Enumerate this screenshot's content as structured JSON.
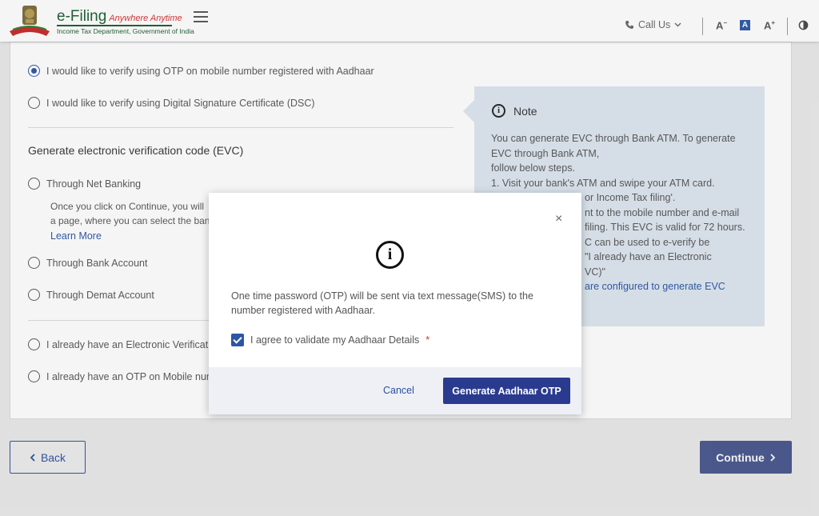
{
  "header": {
    "brand_title": "e-Filing",
    "brand_tagline": "Anywhere Anytime",
    "brand_subtitle": "Income Tax Department, Government of India",
    "call_us": "Call Us",
    "font_decrease": "A",
    "font_default": "A",
    "font_increase": "A"
  },
  "options": {
    "aadhaar_otp": "I would like to verify using OTP on mobile number registered with Aadhaar",
    "dsc": "I would like to verify using Digital Signature Certificate (DSC)",
    "evc_section_title": "Generate electronic verification code (EVC)",
    "net_banking": "Through Net Banking",
    "net_banking_desc_1": "Once you click on Continue, you will",
    "net_banking_desc_2": "a page, where you can select the ban",
    "learn_more": "Learn More",
    "bank_account": "Through Bank Account",
    "demat_account": "Through Demat Account",
    "have_evc": "I already have an Electronic Verificatio",
    "have_otp": "I already have an OTP on Mobile num"
  },
  "note": {
    "title": "Note",
    "lines": [
      "You can generate EVC through Bank ATM. To generate",
      "EVC through Bank ATM,",
      "follow below steps.",
      "1. Visit your bank's ATM and swipe your ATM card.",
      "or Income Tax filing'.",
      "nt to the mobile number and e-mail",
      "filing. This EVC is valid for 72 hours.",
      "C can be used to e-verify be",
      "\"I already have an Electronic",
      "VC)\""
    ],
    "link": "are configured to generate EVC"
  },
  "modal": {
    "close": "×",
    "info_glyph": "i",
    "message": "One time password (OTP) will be sent via text message(SMS) to the number registered with Aadhaar.",
    "agree_label": "I agree to validate my Aadhaar Details",
    "required_mark": "*",
    "cancel": "Cancel",
    "generate_otp": "Generate Aadhaar OTP"
  },
  "footer": {
    "back": "Back",
    "continue": "Continue"
  },
  "colors": {
    "primary": "#2a3b8f",
    "link": "#2b55a6",
    "note_bg": "#dde6ef",
    "required": "#d32f2f"
  }
}
